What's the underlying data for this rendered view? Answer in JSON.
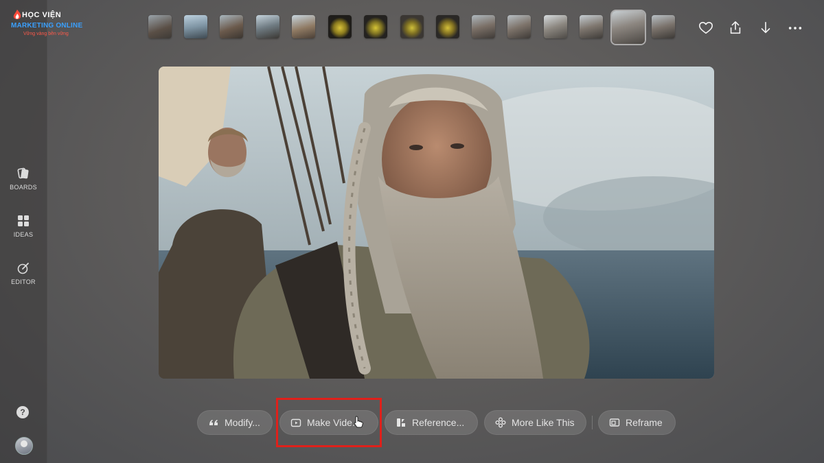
{
  "logo": {
    "line1": "HỌC VIỆN",
    "line2": "MARKETING ONLINE",
    "line3": "Vững vàng bền vững"
  },
  "sidebar": {
    "items": [
      {
        "label": "BOARDS",
        "icon": "boards-icon"
      },
      {
        "label": "IDEAS",
        "icon": "ideas-icon"
      },
      {
        "label": "EDITOR",
        "icon": "editor-icon"
      }
    ],
    "help_label": "?"
  },
  "thumbnails": {
    "count": 15,
    "active_index": 13
  },
  "top_actions": [
    "heart-icon",
    "share-icon",
    "download-icon",
    "more-icon"
  ],
  "toolbar": {
    "modify": "Modify...",
    "make_video": "Make Vide...",
    "reference": "Reference...",
    "more_like_this": "More Like This",
    "reframe": "Reframe"
  },
  "colors": {
    "highlight": "#e0201a",
    "pill_bg": "rgba(255,255,255,0.13)"
  }
}
